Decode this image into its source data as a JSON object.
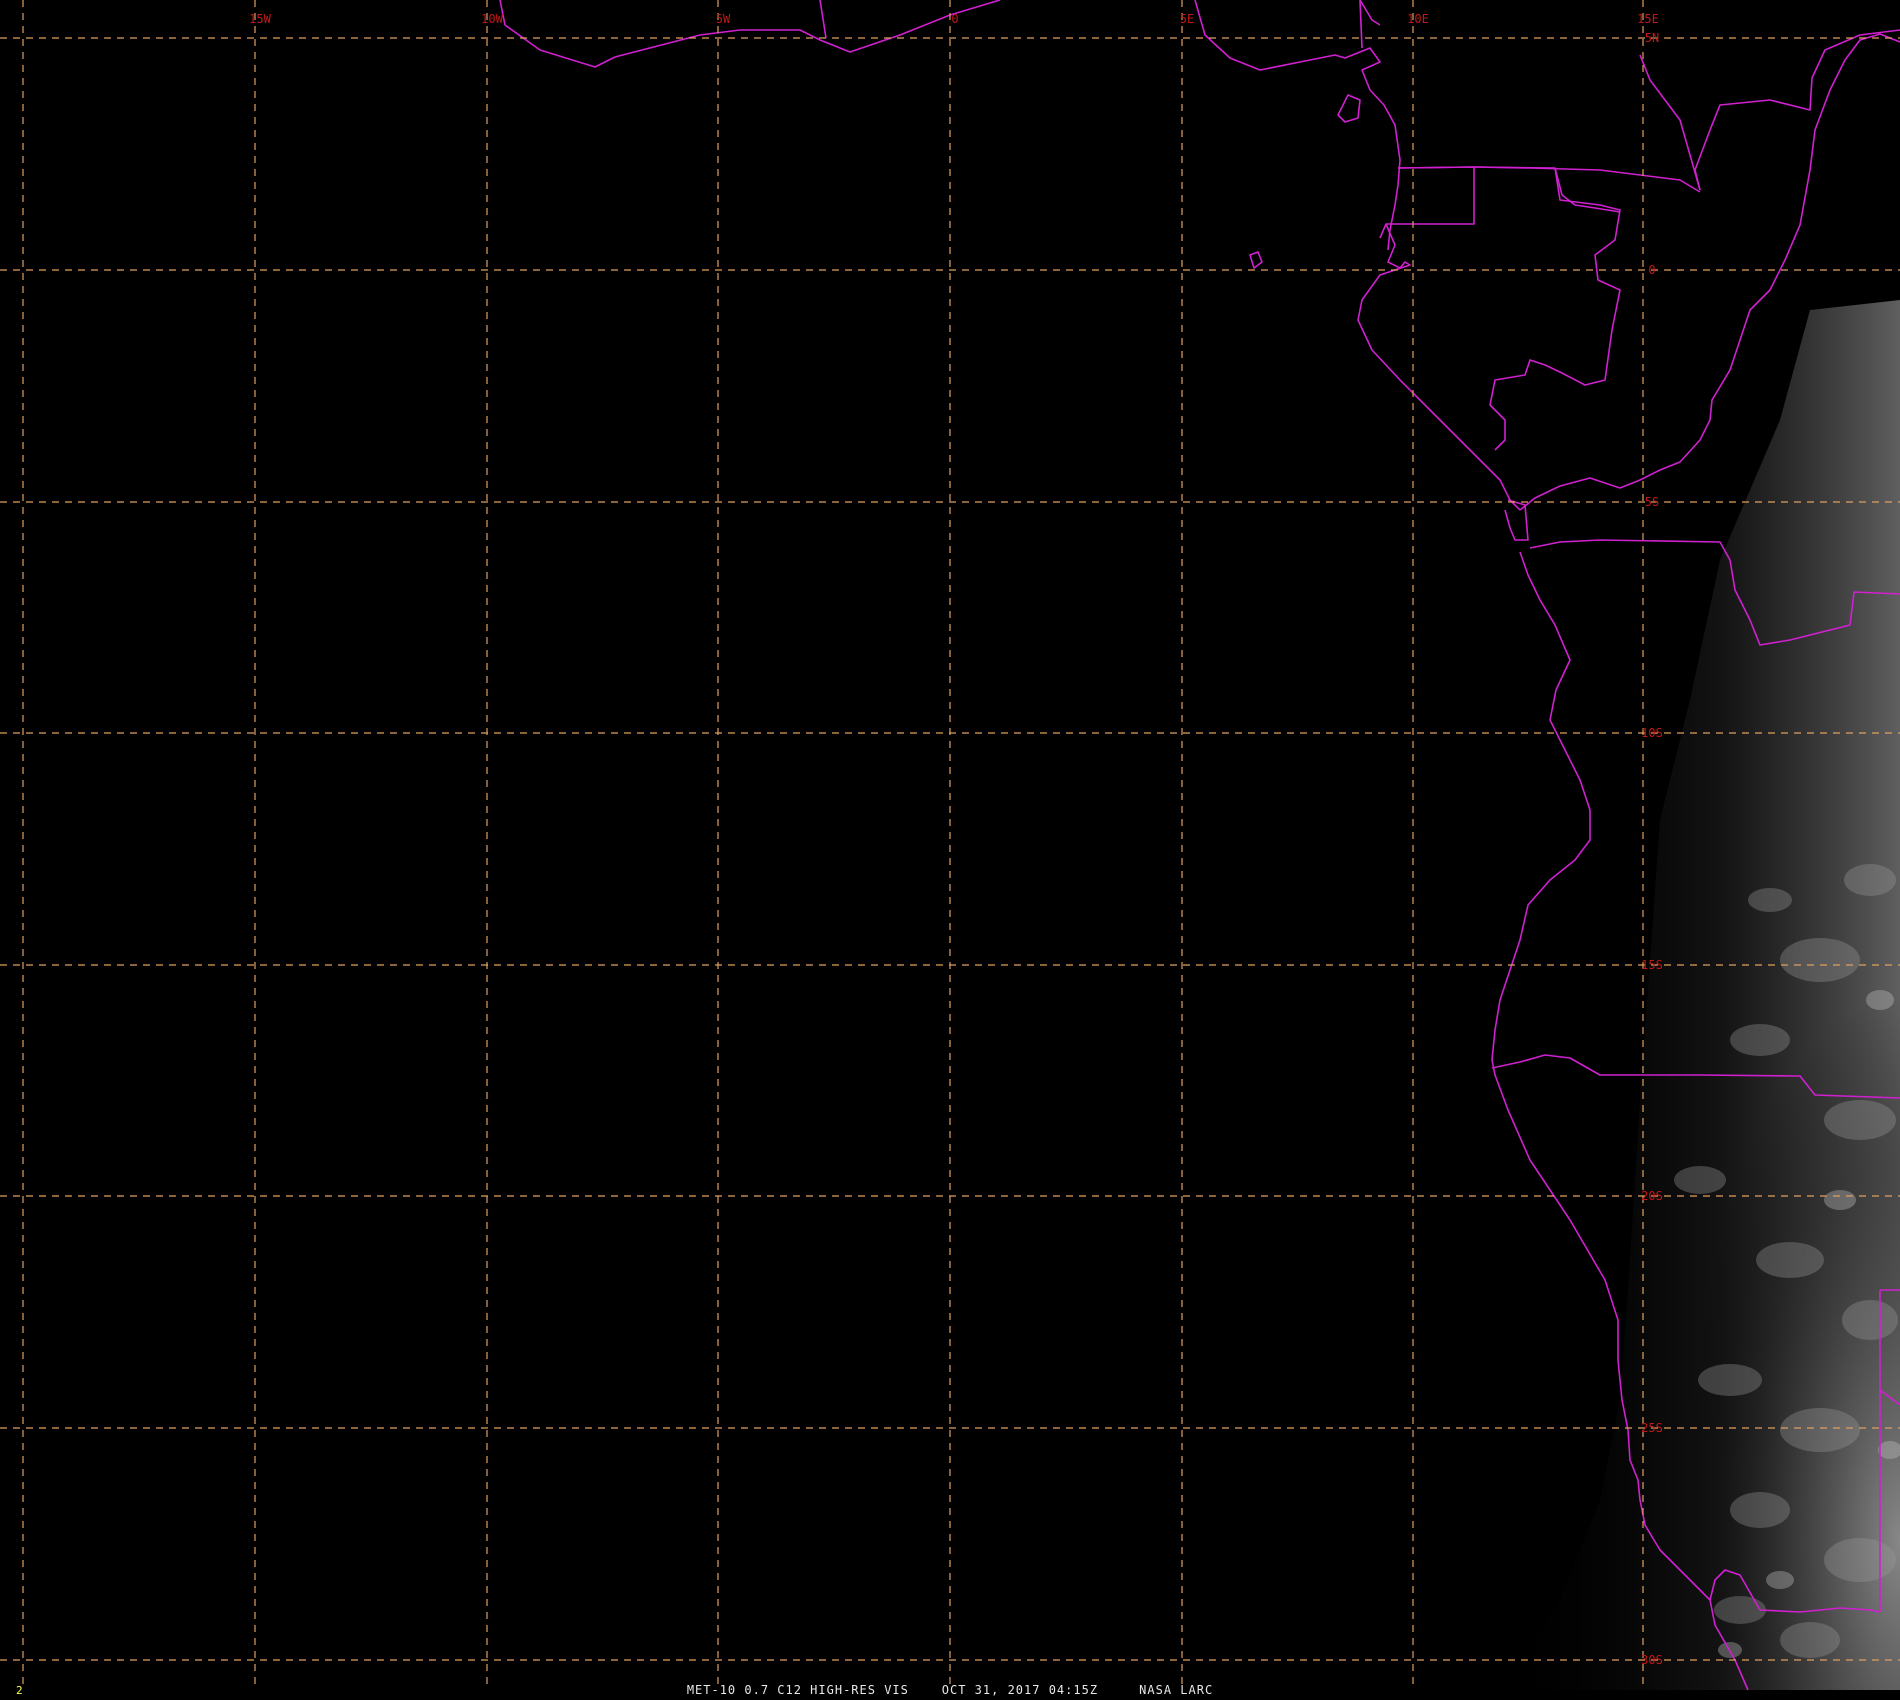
{
  "imagery": {
    "satellite": "MET-10",
    "channel": "0.7 C12 HIGH-RES VIS",
    "date": "OCT 31, 2017",
    "time": "04:15Z",
    "source": "NASA LARC"
  },
  "caption": "MET-10 0.7 C12 HIGH-RES VIS    OCT 31, 2017 04:15Z     NASA LARC",
  "frame_number": "2",
  "grid": {
    "longitude_labels": [
      "15W",
      "10W",
      "5W",
      "0",
      "5E",
      "10E",
      "15E"
    ],
    "latitude_labels": [
      "5N",
      "0",
      "5S",
      "10S",
      "15S",
      "20S",
      "25S",
      "30S"
    ],
    "line_style": "dashed"
  },
  "colors": {
    "background": "#000000",
    "grid": "#e0a060",
    "label": "#c01818",
    "borders": "#d020d0",
    "caption": "#e8e8e8",
    "frame_number": "#ffff44"
  }
}
